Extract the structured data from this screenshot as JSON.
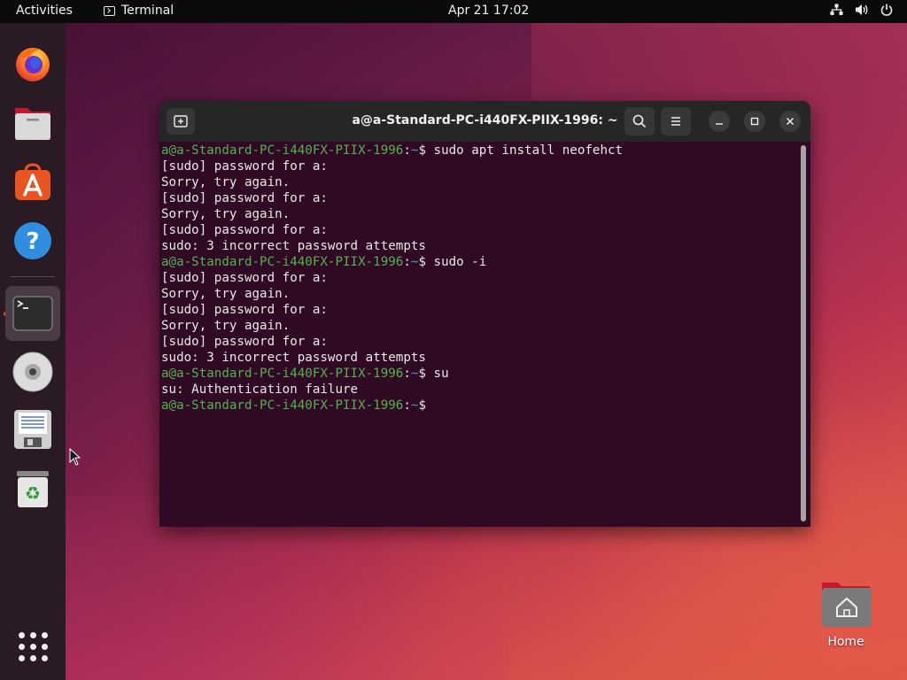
{
  "topbar": {
    "activities": "Activities",
    "app_name": "Terminal",
    "clock": "Apr 21  17:02",
    "tray": {
      "network_icon": "network-icon",
      "volume_icon": "volume-icon",
      "power_icon": "power-icon"
    }
  },
  "dock": {
    "items": [
      {
        "name": "firefox-icon"
      },
      {
        "name": "files-icon"
      },
      {
        "name": "app-center-icon"
      },
      {
        "name": "help-icon"
      },
      {
        "name": "terminal-icon",
        "active": true
      },
      {
        "name": "disc-icon"
      },
      {
        "name": "text-editor-icon"
      },
      {
        "name": "trash-icon"
      },
      {
        "name": "show-apps-icon"
      }
    ]
  },
  "terminal": {
    "title": "a@a-Standard-PC-i440FX-PIIX-1996: ~",
    "prompt_user": "a@a-Standard-PC-i440FX-PIIX-1996",
    "prompt_path": "~",
    "lines": [
      {
        "type": "cmd",
        "text": "sudo apt install neofehct"
      },
      {
        "type": "out",
        "text": "[sudo] password for a:"
      },
      {
        "type": "out",
        "text": "Sorry, try again."
      },
      {
        "type": "out",
        "text": "[sudo] password for a:"
      },
      {
        "type": "out",
        "text": "Sorry, try again."
      },
      {
        "type": "out",
        "text": "[sudo] password for a:"
      },
      {
        "type": "out",
        "text": "sudo: 3 incorrect password attempts"
      },
      {
        "type": "cmd",
        "text": "sudo -i"
      },
      {
        "type": "out",
        "text": "[sudo] password for a:"
      },
      {
        "type": "out",
        "text": "Sorry, try again."
      },
      {
        "type": "out",
        "text": "[sudo] password for a:"
      },
      {
        "type": "out",
        "text": "Sorry, try again."
      },
      {
        "type": "out",
        "text": "[sudo] password for a:"
      },
      {
        "type": "out",
        "text": "sudo: 3 incorrect password attempts"
      },
      {
        "type": "cmd",
        "text": "su"
      },
      {
        "type": "out",
        "text": "su: Authentication failure"
      },
      {
        "type": "cmd",
        "text": ""
      }
    ]
  },
  "desktop": {
    "home_label": "Home"
  },
  "colors": {
    "prompt_user": "#55b24e",
    "prompt_path": "#5b8ed9",
    "terminal_bg": "#300a24"
  }
}
